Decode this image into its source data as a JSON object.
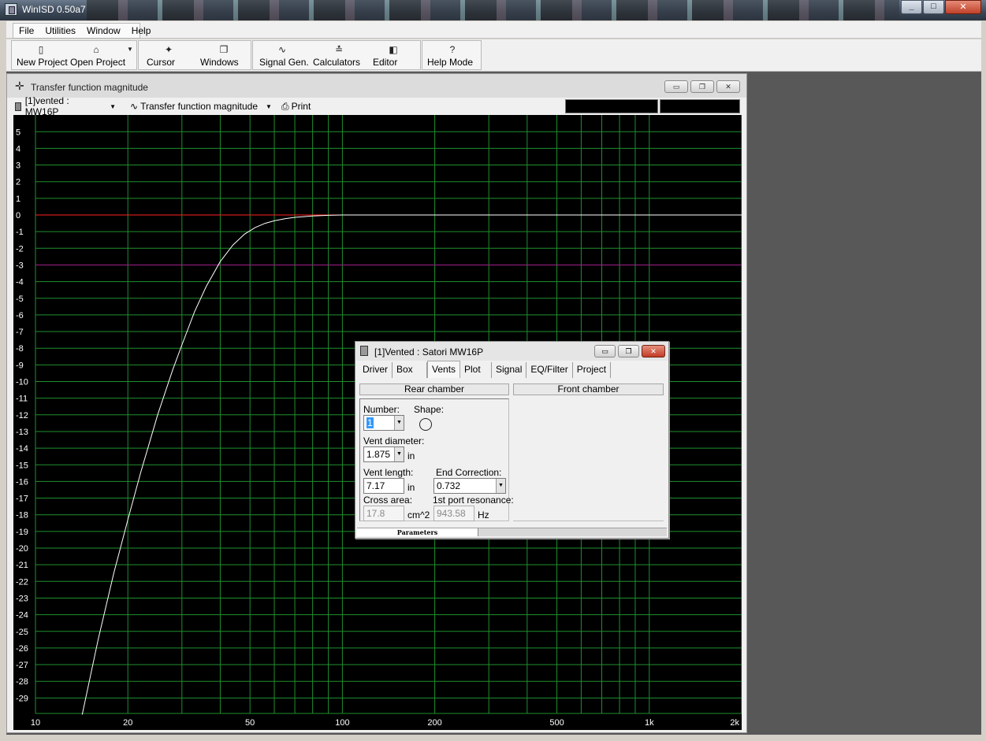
{
  "app": {
    "title": "WinISD 0.50a7"
  },
  "menu": [
    "File",
    "Utilities",
    "Window",
    "Help"
  ],
  "toolbar": {
    "buttons": [
      {
        "label": "New Project",
        "icon": "new-project-icon"
      },
      {
        "label": "Open Project",
        "icon": "open-folder-icon"
      },
      {
        "label": "Cursor",
        "icon": "cursor-crosshair-icon"
      },
      {
        "label": "Windows",
        "icon": "windows-icon"
      },
      {
        "label": "Signal Gen.",
        "icon": "sine-wave-icon"
      },
      {
        "label": "Calculators",
        "icon": "calculator-icon"
      },
      {
        "label": "Editor",
        "icon": "editor-icon"
      },
      {
        "label": "Help Mode",
        "icon": "help-question-icon",
        "glyph": "?"
      }
    ]
  },
  "chart_window": {
    "title": "Transfer function magnitude",
    "project_selector": "[1]vented : MW16P",
    "plot_selector": "Transfer function magnitude",
    "print_label": "Print"
  },
  "chart_data": {
    "type": "line",
    "xscale": "log",
    "xlim": [
      10,
      2000
    ],
    "ylim": [
      -30,
      6
    ],
    "x_ticks": [
      "10",
      "20",
      "50",
      "100",
      "200",
      "500",
      "1k",
      "2k"
    ],
    "y_ticks": [
      "5",
      "4",
      "3",
      "2",
      "1",
      "0",
      "-1",
      "-2",
      "-3",
      "-4",
      "-5",
      "-6",
      "-7",
      "-8",
      "-9",
      "-10",
      "-11",
      "-12",
      "-13",
      "-14",
      "-15",
      "-16",
      "-17",
      "-18",
      "-19",
      "-20",
      "-21",
      "-22",
      "-23",
      "-24",
      "-25",
      "-26",
      "-27",
      "-28",
      "-29"
    ],
    "reference_lines": [
      {
        "y": 0,
        "color": "#ff2020",
        "x_range": [
          10,
          100
        ]
      },
      {
        "y": -3,
        "color": "#a0208a"
      }
    ],
    "grid": true,
    "background": "#000000",
    "grid_color": "#1f8f2f",
    "series": [
      {
        "color": "#ffffff",
        "x": [
          14.2,
          16,
          18,
          20,
          22,
          25,
          28,
          30,
          33,
          36,
          40,
          44,
          48,
          52,
          56,
          60,
          65,
          70,
          80,
          90,
          100,
          120,
          150,
          200,
          500,
          1000,
          2000
        ],
        "y": [
          -30,
          -25.5,
          -21.5,
          -18.3,
          -15.5,
          -12.0,
          -9.3,
          -7.8,
          -5.8,
          -4.3,
          -2.8,
          -1.8,
          -1.15,
          -0.75,
          -0.5,
          -0.35,
          -0.22,
          -0.14,
          -0.06,
          -0.02,
          0,
          0,
          0,
          0,
          0,
          0,
          0
        ]
      }
    ]
  },
  "vent_dialog": {
    "title": "[1]Vented : Satori MW16P",
    "tabs": [
      "Driver",
      "Box",
      "Vents",
      "Plot",
      "Signal",
      "EQ/Filter",
      "Project"
    ],
    "active_tab": "Vents",
    "rear_chamber_label": "Rear chamber",
    "front_chamber_label": "Front chamber",
    "number_label": "Number:",
    "number_value": "1",
    "shape_label": "Shape:",
    "shape_icon": "circle-shape-icon",
    "vent_diameter_label": "Vent diameter:",
    "vent_diameter_value": "1.875",
    "vent_diameter_unit": "in",
    "vent_length_label": "Vent length:",
    "vent_length_value": "7.17",
    "vent_length_unit": "in",
    "end_correction_label": "End Correction:",
    "end_correction_value": "0.732",
    "cross_area_label": "Cross area:",
    "cross_area_value": "17.8",
    "cross_area_unit": "cm^2",
    "port_resonance_label": "1st port resonance:",
    "port_resonance_value": "943.58",
    "port_resonance_unit": "Hz",
    "status_label": "Parameters"
  }
}
